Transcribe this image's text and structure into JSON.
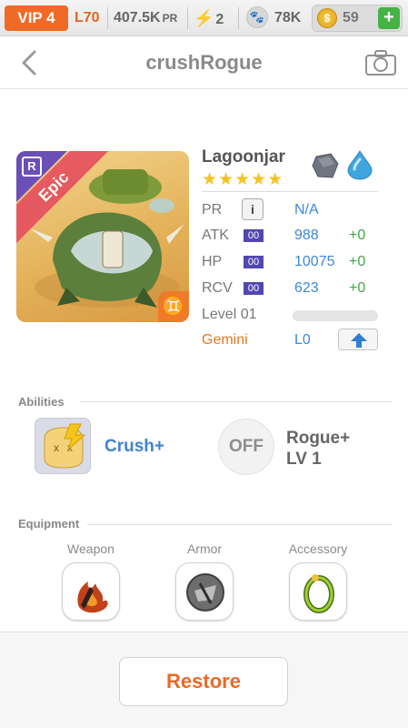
{
  "topbar": {
    "vip": "VIP 4",
    "level": "L70",
    "power": "407.5K",
    "power_unit": "PR",
    "energy": "2",
    "paw_value": "78K",
    "coins": "59",
    "add_label": "+"
  },
  "header": {
    "title": "crushRogue"
  },
  "monster": {
    "name": "Lagoonjar",
    "rarity": "Epic",
    "rank_badge": "R",
    "stars": "★★★★★",
    "star_count": 5,
    "elements": [
      "rock-icon",
      "water-icon"
    ],
    "zodiac_glyph": "♊",
    "stats": [
      {
        "label": "PR",
        "value": "N/A",
        "bonus": ""
      },
      {
        "label": "ATK",
        "badge": "00",
        "value": "988",
        "bonus": "+0"
      },
      {
        "label": "HP",
        "badge": "00",
        "value": "10075",
        "bonus": "+0"
      },
      {
        "label": "RCV",
        "badge": "00",
        "value": "623",
        "bonus": "+0"
      }
    ],
    "level_label": "Level 01",
    "level_progress": 0,
    "sign": "Gemini",
    "sign_level": "L0"
  },
  "abilities": {
    "title": "Abilities",
    "ability1": "Crush+",
    "ability2_state": "OFF",
    "ability2_name": "Rogue+",
    "ability2_level": "LV 1"
  },
  "equipment": {
    "title": "Equipment",
    "slots": [
      "Weapon",
      "Armor",
      "Accessory"
    ]
  },
  "footer": {
    "restore_label": "Restore"
  },
  "colors": {
    "accent_orange": "#ef6a26",
    "stat_blue": "#3c88d8",
    "bonus_green": "#40a844",
    "epic_ribbon": "#e5545f",
    "rank_purple": "#6b4fb6"
  }
}
